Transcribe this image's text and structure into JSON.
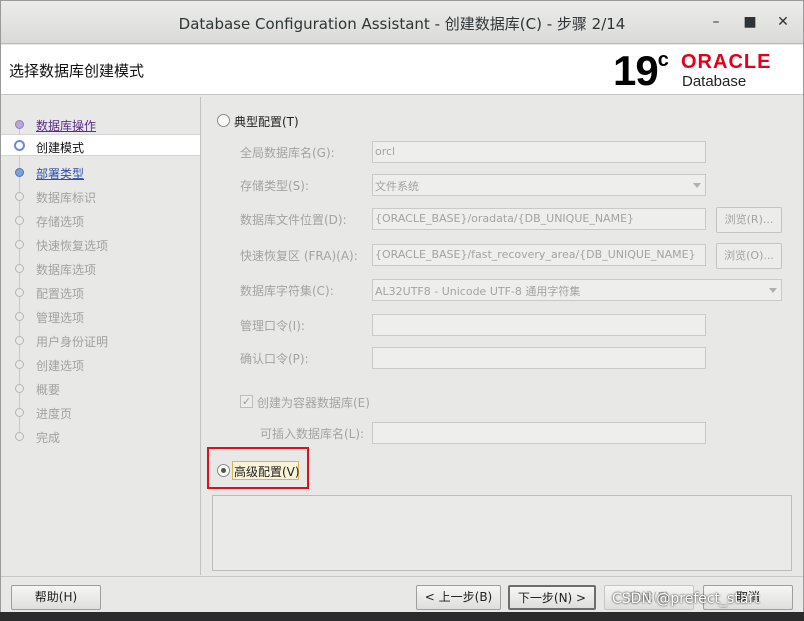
{
  "window": {
    "title": "Database Configuration Assistant - 创建数据库(C) - 步骤 2/14",
    "minimize_icon": "minimize-icon",
    "maximize_icon": "maximize-icon",
    "close_icon": "close-icon"
  },
  "header": {
    "page_title": "选择数据库创建模式",
    "logo_version": "19",
    "logo_version_sup": "c",
    "logo_brand": "ORACLE",
    "logo_product": "Database"
  },
  "sidebar": {
    "steps": [
      {
        "label": "数据库操作",
        "state": "done"
      },
      {
        "label": "创建模式",
        "state": "active"
      },
      {
        "label": "部署类型",
        "state": "link"
      },
      {
        "label": "数据库标识",
        "state": "disabled"
      },
      {
        "label": "存储选项",
        "state": "disabled"
      },
      {
        "label": "快速恢复选项",
        "state": "disabled"
      },
      {
        "label": "数据库选项",
        "state": "disabled"
      },
      {
        "label": "配置选项",
        "state": "disabled"
      },
      {
        "label": "管理选项",
        "state": "disabled"
      },
      {
        "label": "用户身份证明",
        "state": "disabled"
      },
      {
        "label": "创建选项",
        "state": "disabled"
      },
      {
        "label": "概要",
        "state": "disabled"
      },
      {
        "label": "进度页",
        "state": "disabled"
      },
      {
        "label": "完成",
        "state": "disabled"
      }
    ]
  },
  "content": {
    "typical_label": "典型配置(T)",
    "typical_selected": false,
    "global_db_name_label": "全局数据库名(G):",
    "global_db_name_value": "orcl",
    "storage_type_label": "存储类型(S):",
    "storage_type_value": "文件系统",
    "db_file_location_label": "数据库文件位置(D):",
    "db_file_location_value": "{ORACLE_BASE}/oradata/{DB_UNIQUE_NAME}",
    "browse_r_label": "浏览(R)...",
    "fra_label": "快速恢复区 (FRA)(A):",
    "fra_value": "{ORACLE_BASE}/fast_recovery_area/{DB_UNIQUE_NAME}",
    "browse_o_label": "浏览(O)...",
    "charset_label": "数据库字符集(C):",
    "charset_value": "AL32UTF8 - Unicode UTF-8 通用字符集",
    "admin_password_label": "管理口令(I):",
    "admin_password_value": "",
    "confirm_password_label": "确认口令(P):",
    "confirm_password_value": "",
    "container_db_label": "创建为容器数据库(E)",
    "container_db_checked": true,
    "pluggable_db_name_label": "可插入数据库名(L):",
    "pluggable_db_name_value": "",
    "advanced_label": "高级配置(V)",
    "advanced_selected": true,
    "highlight_color": "#e0101a"
  },
  "footer": {
    "help_label": "帮助(H)",
    "back_label": "< 上一步(B)",
    "next_label": "下一步(N) >",
    "finish_label": "完成(F)",
    "cancel_label": "取消"
  },
  "watermark": "CSDN @prefect_start"
}
